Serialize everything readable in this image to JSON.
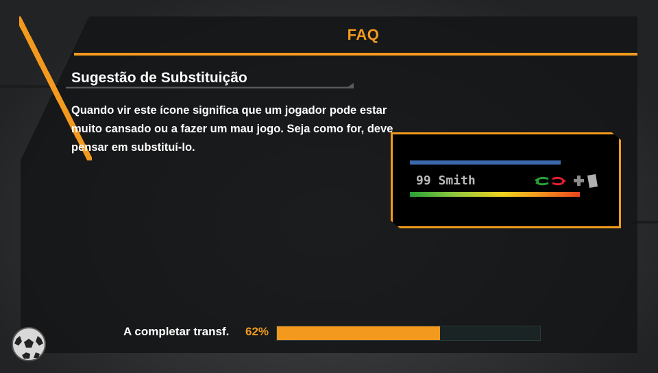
{
  "header": {
    "title": "FAQ"
  },
  "section": {
    "title": "Sugestão de Substituição",
    "body": "Quando vir este ícone significa que um jogador pode estar muito cansado ou a fazer um mau jogo. Seja como for, deve pensar em substituí-lo."
  },
  "preview": {
    "player_label": "99 Smith",
    "icons": [
      "substitution-arrows-icon",
      "injury-cross-icon",
      "card-icon"
    ]
  },
  "progress": {
    "label": "A completar transf.",
    "percent_text": "62%",
    "value": 0.62
  },
  "colors": {
    "accent": "#f39a1e",
    "panel": "#141516",
    "bar_blue": "#3c68ad",
    "sub_green": "#27a135",
    "sub_red": "#e0202a"
  },
  "decor": {
    "ball_icon": "soccer-ball-icon"
  }
}
